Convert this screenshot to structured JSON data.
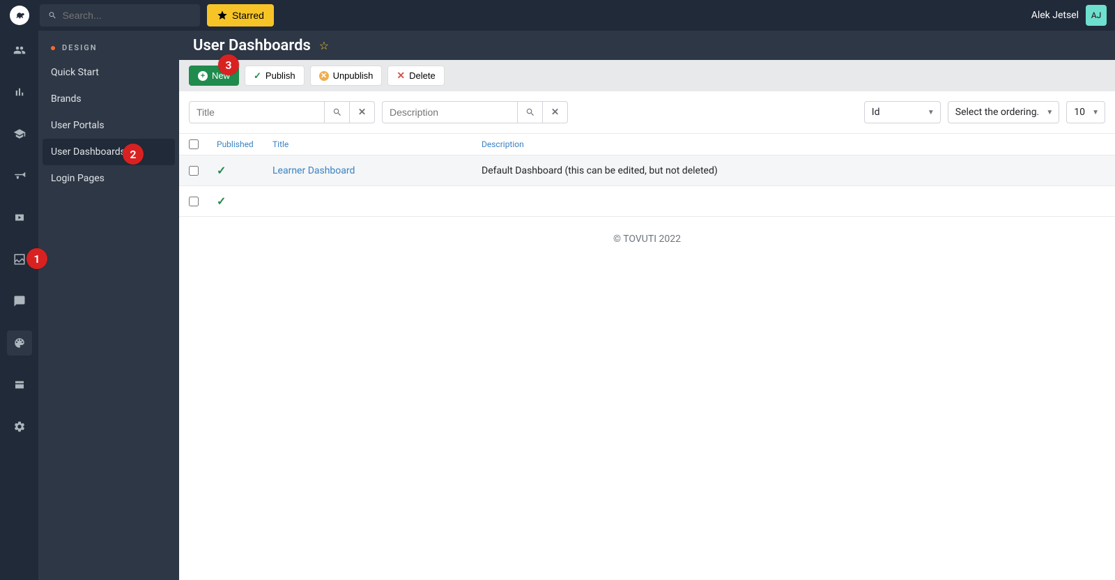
{
  "topbar": {
    "search_placeholder": "Search...",
    "starred_label": "Starred",
    "user_name": "Alek Jetsel",
    "user_initials": "AJ"
  },
  "sidebar": {
    "header": "DESIGN",
    "items": [
      {
        "label": "Quick Start"
      },
      {
        "label": "Brands"
      },
      {
        "label": "User Portals"
      },
      {
        "label": "User Dashboards"
      },
      {
        "label": "Login Pages"
      }
    ]
  },
  "page": {
    "title": "User Dashboards"
  },
  "toolbar": {
    "new_label": "New",
    "publish_label": "Publish",
    "unpublish_label": "Unpublish",
    "delete_label": "Delete"
  },
  "filters": {
    "title_placeholder": "Title",
    "desc_placeholder": "Description",
    "sort_field": "Id",
    "sort_order": "Select the ordering.",
    "page_size": "10"
  },
  "table": {
    "headers": {
      "published": "Published",
      "title": "Title",
      "description": "Description"
    },
    "rows": [
      {
        "published": true,
        "title": "Learner Dashboard",
        "description": "Default Dashboard (this can be edited, but not deleted)"
      },
      {
        "published": true,
        "title": "",
        "description": ""
      }
    ]
  },
  "footer": {
    "copyright": "© TOVUTI 2022"
  },
  "annotations": {
    "b1": "1",
    "b2": "2",
    "b3": "3"
  }
}
